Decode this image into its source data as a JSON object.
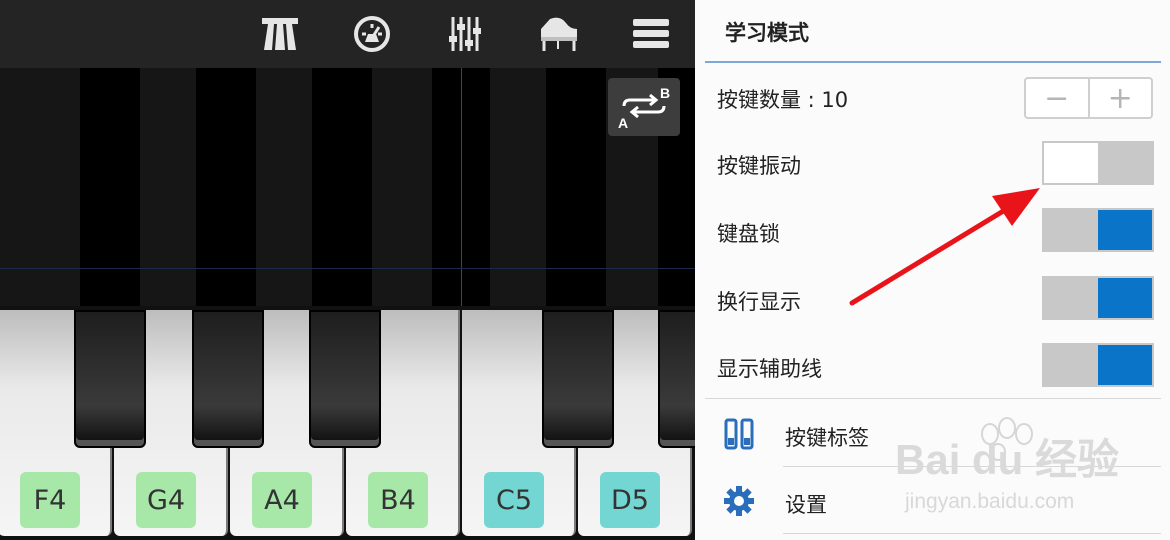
{
  "toolbar": {
    "icons": [
      "tuning-fork-icon",
      "metronome-icon",
      "mixer-sliders-icon",
      "grand-piano-icon",
      "menu-hamburger-icon"
    ]
  },
  "ab_button": {
    "label_a": "A",
    "label_b": "B"
  },
  "keyboard": {
    "notes": [
      {
        "label": "F4",
        "color": "#a7e8a8"
      },
      {
        "label": "G4",
        "color": "#a7e8a8"
      },
      {
        "label": "A4",
        "color": "#a7e8a8"
      },
      {
        "label": "B4",
        "color": "#a7e8a8"
      },
      {
        "label": "C5",
        "color": "#74d6d2"
      },
      {
        "label": "D5",
        "color": "#74d6d2"
      }
    ]
  },
  "panel": {
    "title": "学习模式",
    "key_count_label": "按键数量 : 10",
    "stepper_minus": "−",
    "stepper_plus": "+",
    "rows": [
      {
        "label": "按键振动",
        "on": false
      },
      {
        "label": "键盘锁",
        "on": true
      },
      {
        "label": "换行显示",
        "on": true
      },
      {
        "label": "显示辅助线",
        "on": true
      }
    ],
    "menu": [
      {
        "label": "按键标签",
        "icon": "key-labels-icon"
      },
      {
        "label": "设置",
        "icon": "gear-icon"
      }
    ]
  },
  "colors": {
    "toggle_on": "#0a74c8",
    "toggle_off": "#c8c8c8",
    "accent_line": "#7fa6d8",
    "arrow": "#e8141a"
  },
  "watermark": {
    "brand": "Bai du 经验",
    "url": "jingyan.baidu.com"
  }
}
